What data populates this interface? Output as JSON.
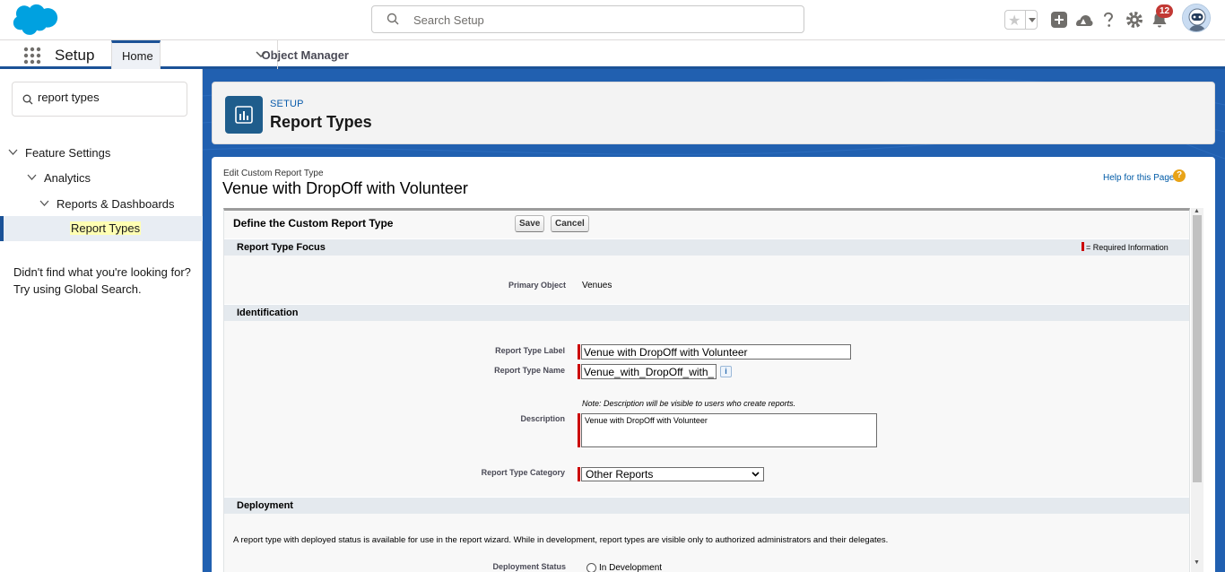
{
  "header": {
    "search_placeholder": "Search Setup",
    "notification_count": "12",
    "icons": [
      "salesforce-cloud-logo",
      "star-icon",
      "add-icon",
      "trailhead-icon",
      "help-icon",
      "gear-icon",
      "bell-icon",
      "avatar"
    ]
  },
  "nav": {
    "app_name": "Setup",
    "tabs": [
      {
        "label": "Home"
      },
      {
        "label": "Object Manager"
      }
    ]
  },
  "sidebar": {
    "quick_find_value": "report types",
    "tree": [
      {
        "label": "Feature Settings"
      },
      {
        "label": "Analytics"
      },
      {
        "label": "Reports & Dashboards"
      },
      {
        "label": "Report Types"
      }
    ],
    "help_line1": "Didn't find what you're looking for?",
    "help_line2": "Try using Global Search."
  },
  "page_header": {
    "overline": "SETUP",
    "title": "Report Types"
  },
  "content": {
    "crumb": "Edit Custom Report Type",
    "title": "Venue with DropOff with Volunteer",
    "help_link": "Help for this Page",
    "block_title": "Define the Custom Report Type",
    "save_label": "Save",
    "cancel_label": "Cancel",
    "required_legend": "= Required Information",
    "sections": {
      "focus": "Report Type Focus",
      "identification": "Identification",
      "deployment": "Deployment"
    },
    "fields": {
      "primary_object_label": "Primary Object",
      "primary_object_value": "Venues",
      "label_label": "Report Type Label",
      "label_value": "Venue with DropOff with Volunteer",
      "name_label": "Report Type Name",
      "name_value": "Venue_with_DropOff_with_",
      "description_note": "Note: Description will be visible to users who create reports.",
      "description_label": "Description",
      "description_value": "Venue with DropOff with Volunteer",
      "category_label": "Report Type Category",
      "category_value": "Other Reports",
      "deployment_text": "A report type with deployed status is available for use in the report wizard. While in development, report types are visible only to authorized administrators and their delegates.",
      "deployment_status_label": "Deployment Status",
      "deployment_option": "In Development"
    }
  },
  "colors": {
    "brand_blue": "#1b5297",
    "background_blue": "#2160b0",
    "required_red": "#c00"
  }
}
